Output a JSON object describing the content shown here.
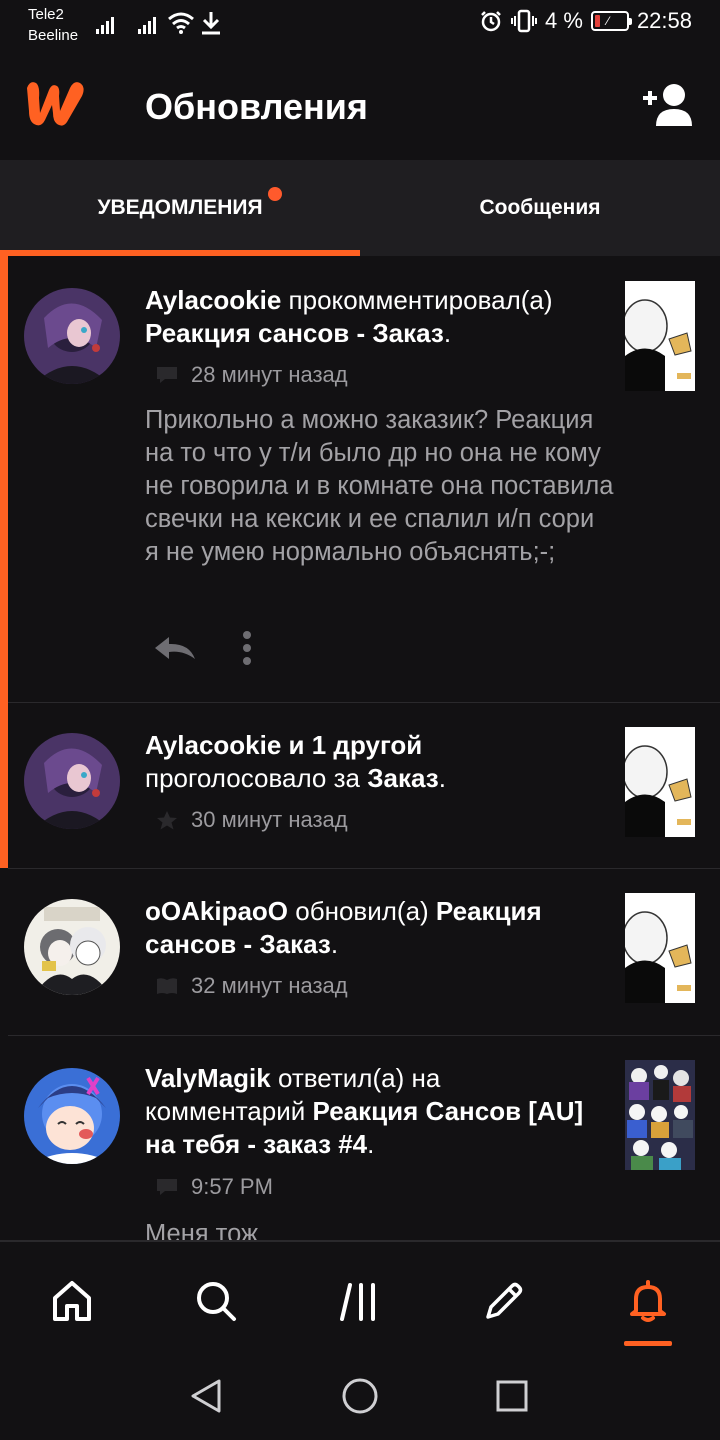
{
  "status": {
    "carrier1": "Tele2",
    "carrier2": "Beeline",
    "battery": "4 %",
    "time": "22:58"
  },
  "header": {
    "title": "Обновления"
  },
  "tabs": {
    "notifications": "УВЕДОМЛЕНИЯ",
    "messages": "Сообщения"
  },
  "notifications": [
    {
      "user": "Aylacookie",
      "action": " прокомментировал(а) ",
      "target": "Реакция сансов - Заказ",
      "suffix": ".",
      "time": "28 минут назад",
      "comment": "Прикольно а можно заказик? Реакция на то что у т/и было др но она не кому не говорила и в комнате она поставила свечки на кексик и ее спалил и/п сори я не умею нормально объяснять;-;"
    },
    {
      "user": "Aylacookie и 1 другой",
      "action": "проголосовало за ",
      "target": "Заказ",
      "suffix": ".",
      "time": "30 минут назад"
    },
    {
      "user": "oOAkipaoO",
      "action": " обновил(а) ",
      "target": "Реакция сансов - Заказ",
      "suffix": ".",
      "time": "32 минут назад"
    },
    {
      "user": "ValyMagik",
      "action": " ответил(а) на комментарий ",
      "target": "Реакция Сансов [AU] на тебя - заказ #4",
      "suffix": ".",
      "time": "9:57 PM",
      "comment": "Меня тож"
    }
  ],
  "colors": {
    "accent": "#ff6122",
    "background": "#121113",
    "tabbar": "#1f1e21",
    "muted_text": "#9c9b9f"
  },
  "icons": {
    "nav": [
      "home-icon",
      "search-icon",
      "library-icon",
      "pencil-icon",
      "bell-icon"
    ],
    "system": [
      "back-icon",
      "home-circle-icon",
      "recents-icon"
    ]
  }
}
